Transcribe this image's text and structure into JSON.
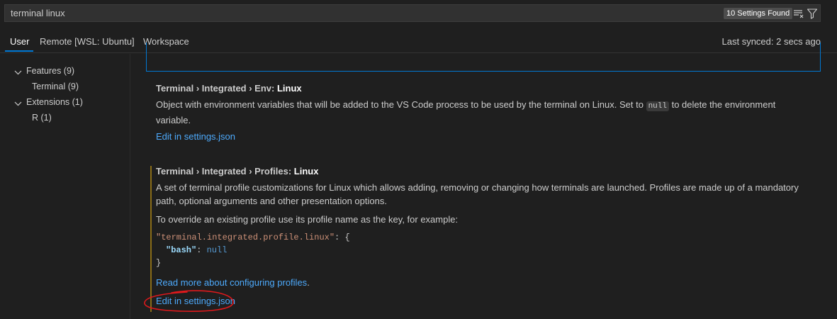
{
  "search": {
    "value": "terminal linux",
    "results_count": "10 Settings Found",
    "clear_filters_icon": "clear-filter-icon",
    "filter_icon": "filter-icon"
  },
  "tabs": [
    {
      "label": "User",
      "active": true
    },
    {
      "label": "Remote [WSL: Ubuntu]",
      "active": false
    },
    {
      "label": "Workspace",
      "active": false
    }
  ],
  "sync_status": "Last synced: 2 secs ago",
  "toc": [
    {
      "label": "Features (9)",
      "expanded": true
    },
    {
      "label": "Terminal (9)"
    },
    {
      "label": "Extensions (1)",
      "expanded": true
    },
    {
      "label": "R (1)"
    }
  ],
  "settings": [
    {
      "category": "Terminal › Integrated › Env: ",
      "key": "Linux",
      "description_pre": "Object with environment variables that will be added to the VS Code process to be used by the terminal on Linux. Set to ",
      "description_code": "null",
      "description_post": " to delete the environment variable.",
      "edit_link": "Edit in settings.json"
    },
    {
      "category": "Terminal › Integrated › Profiles: ",
      "key": "Linux",
      "description": "A set of terminal profile customizations for Linux which allows adding, removing or changing how terminals are launched. Profiles are made up of a mandatory path, optional arguments and other presentation options.",
      "description2": "To override an existing profile use its profile name as the key, for example:",
      "code_line1_key": "\"terminal.integrated.profile.linux\"",
      "code_line1_rest": ": {",
      "code_line2_key": "\"bash\"",
      "code_line2_sep": ": ",
      "code_line2_val": "null",
      "code_line3": "}",
      "read_more_link": "Read more about configuring profiles",
      "read_more_suffix": ".",
      "edit_link": "Edit in settings.json"
    }
  ],
  "colors": {
    "accent": "#0078d4",
    "link": "#4daafc",
    "modified_indicator": "#8a6d18",
    "annotation": "#e0191c"
  }
}
